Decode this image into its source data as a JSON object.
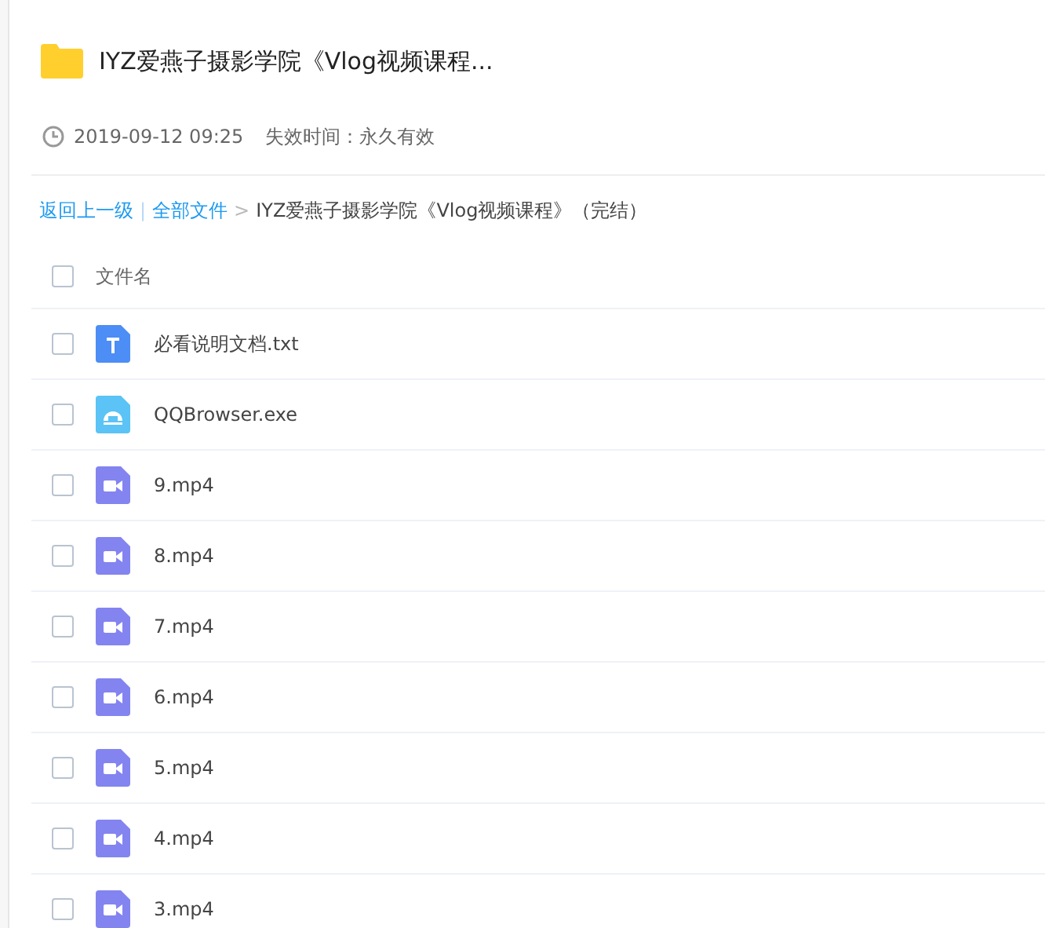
{
  "title": "IYZ爱燕子摄影学院《Vlog视频课程...",
  "meta": {
    "date": "2019-09-12 09:25",
    "expiry": "失效时间：永久有效"
  },
  "breadcrumb": {
    "back": "返回上一级",
    "separator": "|",
    "root": "全部文件",
    "arrow": ">",
    "current": "IYZ爱燕子摄影学院《Vlog视频课程》（完结）"
  },
  "header": {
    "checked": false,
    "label": "文件名"
  },
  "files": [
    {
      "name": "必看说明文档.txt",
      "kind": "text",
      "checked": false
    },
    {
      "name": "QQBrowser.exe",
      "kind": "exe",
      "checked": false
    },
    {
      "name": "9.mp4",
      "kind": "video",
      "checked": false
    },
    {
      "name": "8.mp4",
      "kind": "video",
      "checked": false
    },
    {
      "name": "7.mp4",
      "kind": "video",
      "checked": false
    },
    {
      "name": "6.mp4",
      "kind": "video",
      "checked": false
    },
    {
      "name": "5.mp4",
      "kind": "video",
      "checked": false
    },
    {
      "name": "4.mp4",
      "kind": "video",
      "checked": false
    },
    {
      "name": "3.mp4",
      "kind": "video",
      "checked": false
    }
  ]
}
